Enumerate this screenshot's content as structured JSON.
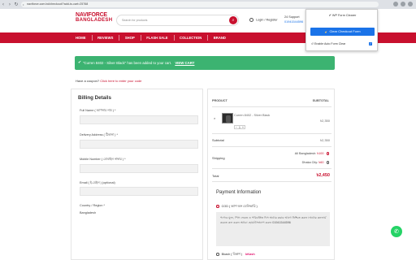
{
  "browser": {
    "url": "naviforce.com.bd/checkout/?add-to-cart=25768"
  },
  "header": {
    "logo_line1": "NAVIFORCE",
    "logo_line2": "BANGLADESH",
    "search_placeholder": "Search for products",
    "login_label": "Login / Register",
    "support_label": "24 Support",
    "support_phone": "01941544596"
  },
  "nav": {
    "items": [
      "HOME",
      "REVIEWS",
      "SHOP",
      "FLASH SALE",
      "COLLECTION",
      "BRAND"
    ]
  },
  "notice": {
    "message": "\"Curren 8402 - Silver Black\" has been added to your cart.",
    "action": "VIEW CART"
  },
  "coupon": {
    "text": "Have a coupon?",
    "link": "Click here to enter your code"
  },
  "billing": {
    "title": "Billing Details",
    "fields": {
      "name_label": "Full Name ( আপনার নাম ) *",
      "address_label": "Delivery Address ( ঠিকানা ) *",
      "mobile_label": "Mobile Number ( মোবাইল নাম্বার ) *",
      "email_label": "Email ( ই-মেইল ) (optional)",
      "country_label": "Country / Region *",
      "country_value": "Bangladesh"
    }
  },
  "order": {
    "col_product": "PRODUCT",
    "col_subtotal": "SUBTOTAL",
    "product_name": "Curren 8402 - Silver Black",
    "qty": "1",
    "price": "৳2,350",
    "subtotal_label": "Subtotal",
    "subtotal_value": "৳2,350",
    "shipping_label": "Shipping",
    "ship_option1": "All Bangladesh:",
    "ship_option1_amt": "৳100",
    "ship_option2": "Dhaka City:",
    "ship_option2_amt": "৳60",
    "total_label": "Total",
    "total_value": "৳2,450",
    "payment_title": "Payment Information",
    "cod_label": "COD ( ক্যাশ অন ডেলিভারি )",
    "cod_note": "পণ্যের মূল্য, পিস ফেরত ও পরিবর্তিত দিস অর্ডার করার আগে নিশ্চিত করুন। অর্ডার কনফার্ম করতে কল করুন অথবা হোয়াটসঅ্যাপ করুন 01941544596",
    "bkash_label": "Bkash ( বিকাশ )",
    "bkash_logo": "bKash"
  },
  "popup": {
    "title": "WP Form Clearer",
    "button": "Clear Checkout Form",
    "checkbox_label": "Enable Auto Form Clear"
  }
}
